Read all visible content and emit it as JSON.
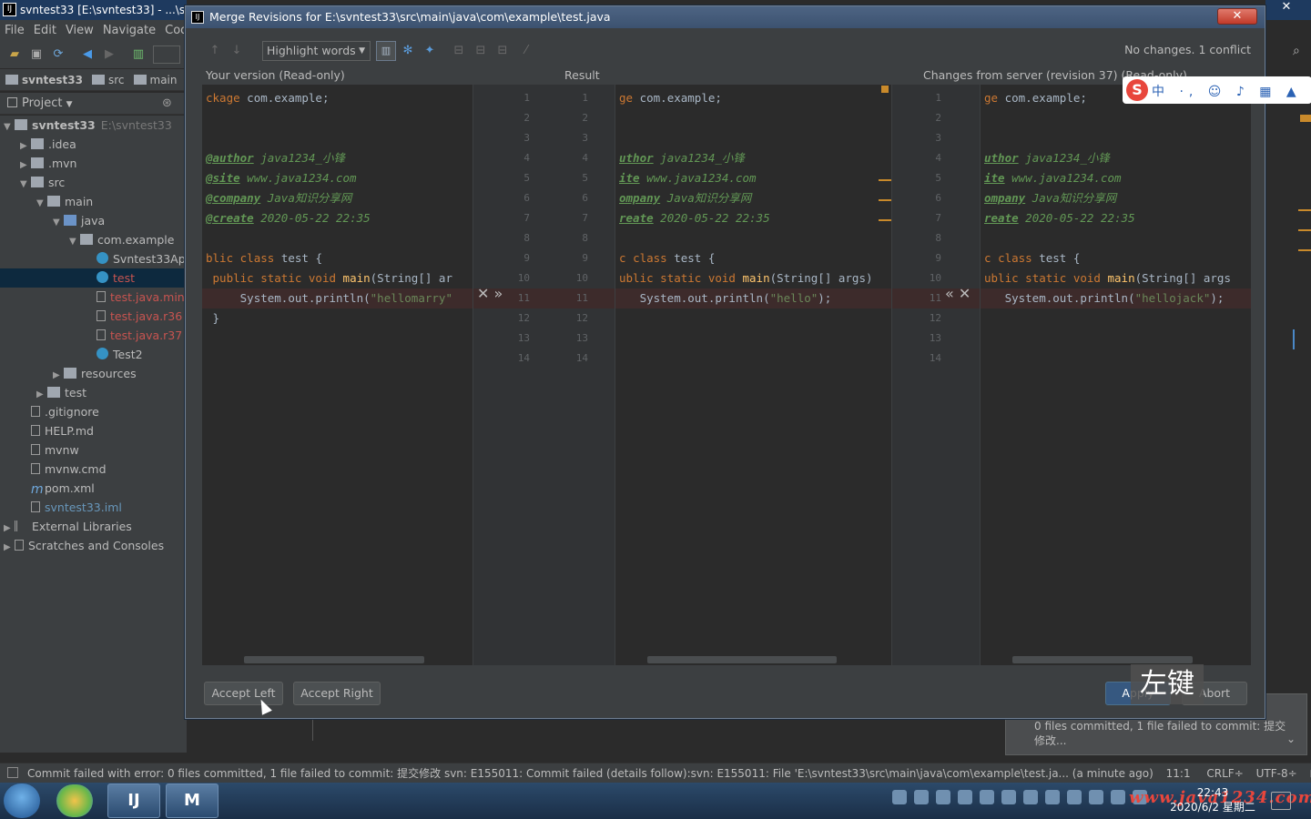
{
  "ide": {
    "title": "svntest33 [E:\\svntest33] - ...\\src",
    "menu": [
      "File",
      "Edit",
      "View",
      "Navigate",
      "Cod"
    ],
    "breadcrumbs": [
      "svntest33",
      "src",
      "main"
    ],
    "project_header": "Project",
    "tree": [
      {
        "label": "svntest33",
        "extra": "E:\\svntest33",
        "level": 0,
        "arrow": "▼",
        "icon": "folder",
        "bold": true
      },
      {
        "label": ".idea",
        "level": 1,
        "arrow": "▶",
        "icon": "folder"
      },
      {
        "label": ".mvn",
        "level": 1,
        "arrow": "▶",
        "icon": "folder"
      },
      {
        "label": "src",
        "level": 1,
        "arrow": "▼",
        "icon": "folder"
      },
      {
        "label": "main",
        "level": 2,
        "arrow": "▼",
        "icon": "folder"
      },
      {
        "label": "java",
        "level": 3,
        "arrow": "▼",
        "icon": "folder-blue"
      },
      {
        "label": "com.example",
        "level": 4,
        "arrow": "▼",
        "icon": "folder"
      },
      {
        "label": "Svntest33Ap",
        "level": 5,
        "arrow": "",
        "icon": "class"
      },
      {
        "label": "test",
        "level": 5,
        "arrow": "",
        "icon": "class",
        "selected": true,
        "color": "red"
      },
      {
        "label": "test.java.min",
        "level": 5,
        "arrow": "",
        "icon": "file",
        "color": "red"
      },
      {
        "label": "test.java.r36",
        "level": 5,
        "arrow": "",
        "icon": "file",
        "color": "red"
      },
      {
        "label": "test.java.r37",
        "level": 5,
        "arrow": "",
        "icon": "file",
        "color": "red"
      },
      {
        "label": "Test2",
        "level": 5,
        "arrow": "",
        "icon": "class"
      },
      {
        "label": "resources",
        "level": 3,
        "arrow": "▶",
        "icon": "folder"
      },
      {
        "label": "test",
        "level": 2,
        "arrow": "▶",
        "icon": "folder"
      },
      {
        "label": ".gitignore",
        "level": 1,
        "arrow": "",
        "icon": "file"
      },
      {
        "label": "HELP.md",
        "level": 1,
        "arrow": "",
        "icon": "file"
      },
      {
        "label": "mvnw",
        "level": 1,
        "arrow": "",
        "icon": "file"
      },
      {
        "label": "mvnw.cmd",
        "level": 1,
        "arrow": "",
        "icon": "file"
      },
      {
        "label": "pom.xml",
        "level": 1,
        "arrow": "",
        "icon": "maven"
      },
      {
        "label": "svntest33.iml",
        "level": 1,
        "arrow": "",
        "icon": "file",
        "color": "blue"
      },
      {
        "label": "External Libraries",
        "level": 0,
        "arrow": "▶",
        "icon": "lib"
      },
      {
        "label": "Scratches and Consoles",
        "level": 0,
        "arrow": "▶",
        "icon": "scratch"
      }
    ],
    "status": "Commit failed with error: 0 files committed, 1 file failed to commit: 提交修改 svn: E155011: Commit failed (details follow):svn: E155011: File 'E:\\svntest33\\src\\main\\java\\com\\example\\test.ja... (a minute ago)",
    "status_right": [
      "11:1",
      "CRLF÷",
      "UTF-8÷"
    ],
    "notification": "0 files committed, 1 file failed to commit: 提交修改..."
  },
  "dialog": {
    "title": "Merge Revisions for E:\\svntest33\\src\\main\\java\\com\\example\\test.java",
    "close_label": "✕",
    "highlight_mode": "Highlight words",
    "conflict_status": "No changes. 1 conflict",
    "labels": {
      "left": "Your version (Read-only)",
      "center": "Result",
      "right": "Changes from server (revision 37) (Read-only)"
    },
    "line_numbers": [
      "1",
      "2",
      "3",
      "4",
      "5",
      "6",
      "7",
      "8",
      "9",
      "10",
      "11",
      "12",
      "13",
      "14"
    ],
    "conflict_line": 11,
    "left_code": [
      "ckage com.example;",
      "",
      "",
      "@author java1234_小锋",
      "@site www.java1234.com",
      "@company Java知识分享网",
      "@create 2020-05-22 22:35",
      "",
      "blic class test {",
      " public static void main(String[] ar",
      "     System.out.println(\"hellomarry\"",
      " }",
      "",
      ""
    ],
    "center_code": [
      "ge com.example;",
      "",
      "",
      "uthor java1234_小锋",
      "ite www.java1234.com",
      "ompany Java知识分享网",
      "reate 2020-05-22 22:35",
      "",
      "c class test {",
      "ublic static void main(String[] args)",
      "   System.out.println(\"hello\");",
      "",
      "",
      ""
    ],
    "right_code": [
      "ge com.example;",
      "",
      "",
      "uthor java1234_小锋",
      "ite www.java1234.com",
      "ompany Java知识分享网",
      "reate 2020-05-22 22:35",
      "",
      "c class test {",
      "ublic static void main(String[] args",
      "   System.out.println(\"hellojack\");",
      "",
      "",
      ""
    ],
    "left_apply": "✕ »",
    "right_apply": "« ✕",
    "buttons": {
      "accept_left": "Accept Left",
      "accept_right": "Accept Right",
      "apply": "Apply",
      "abort": "Abort"
    }
  },
  "overlay_text": "左键",
  "taskbar": {
    "clock_time": "22:43",
    "clock_date": "2020/6/2 星期二",
    "watermark": "www.java1234.com",
    "ide_btn": "IJ",
    "m_btn": "M"
  },
  "ime": {
    "logo": "S",
    "rest": "中 ·, ☺ ♪ ▦ ▲ ▦"
  },
  "colors": {
    "conflict": "#3d2b2b",
    "accent": "#365880",
    "change": "#c98a2b"
  }
}
